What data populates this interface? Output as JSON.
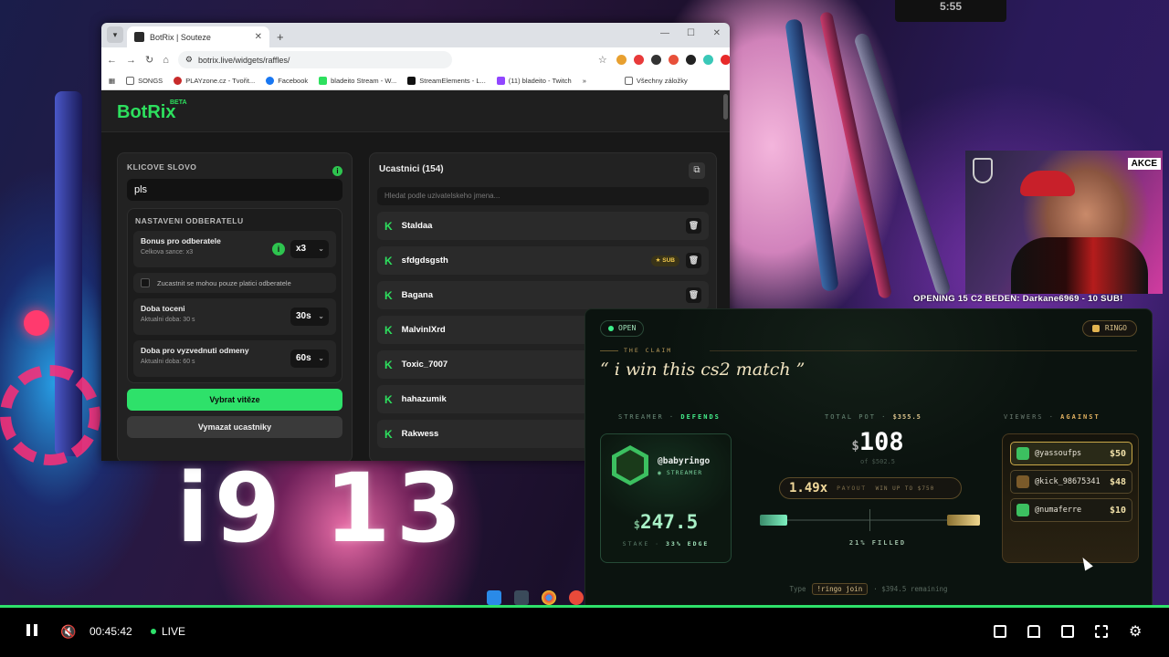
{
  "stream": {
    "top_marker": "5:55",
    "overlay_big_text": "i9 13",
    "ticker": "OPENING 15 C2 BEDEN: Darkane6969 - 10 SUB!",
    "cam_badge": "AKCE"
  },
  "browser": {
    "tab_title": "BotRix | Souteze",
    "url": "botrix.live/widgets/raffles/",
    "bookmarks": [
      "SONGS",
      "PLAYzone.cz - Tvořit...",
      "Facebook",
      "bladeito Stream - W...",
      "StreamElements - L...",
      "(11) bladeito - Twitch"
    ],
    "bookmarks_all": "Všechny záložky"
  },
  "botrix": {
    "brand": "BotRix",
    "beta": "BETA",
    "keyword_label": "KLICOVE SLOVO",
    "keyword_value": "pls",
    "sub_settings_label": "NASTAVENI ODBERATELU",
    "bonus": {
      "title": "Bonus pro odberatele",
      "subtitle": "Celkova sance: x3",
      "value": "x3"
    },
    "only_subs": "Zucastnit se mohou pouze platici odberatele",
    "spin": {
      "title": "Doba toceni",
      "subtitle": "Aktualni doba: 30 s",
      "value": "30s"
    },
    "claim": {
      "title": "Doba pro vyzvednuti odmeny",
      "subtitle": "Aktualni doba: 60 s",
      "value": "60s"
    },
    "pick_winner": "Vybrat vitěze",
    "clear_participants": "Vymazat ucastniky",
    "participants_title": "Ucastnici (154)",
    "search_placeholder": "Hledat podle uzivatelskeho jmena...",
    "participants": [
      {
        "name": "Staldaa",
        "badge": ""
      },
      {
        "name": "sfdgdsgsth",
        "badge": "SUB"
      },
      {
        "name": "Bagana",
        "badge": ""
      },
      {
        "name": "MalvinlXrd",
        "badge": ""
      },
      {
        "name": "Toxic_7007",
        "badge": ""
      },
      {
        "name": "hahazumik",
        "badge": ""
      },
      {
        "name": "Rakwess",
        "badge": ""
      }
    ]
  },
  "ringo": {
    "status": "OPEN",
    "brand": "RINGO",
    "claim_label": "THE CLAIM",
    "claim": "“ i win this cs2 match ”",
    "streamer_label": "STREAMER",
    "streamer_side": "DEFENDS",
    "streamer_handle": "@babyringo",
    "streamer_role": "STREAMER",
    "stake_amount": "247.5",
    "stake_label": "STAKE",
    "stake_edge": "33% EDGE",
    "pot_label": "TOTAL POT",
    "pot_total": "$355.5",
    "pot_amount": "108",
    "pot_of": "of $502.5",
    "multiplier": "1.49x",
    "payout_label": "PAYOUT",
    "win_up_to": "WIN UP TO $750",
    "filled_pct": 21,
    "filled_label": "21% FILLED",
    "viewers_label": "VIEWERS",
    "viewers_side": "AGAINST",
    "viewers": [
      {
        "name": "@yassoufps",
        "amount": "$50"
      },
      {
        "name": "@kick_98675341",
        "amount": "$48"
      },
      {
        "name": "@numaferre",
        "amount": "$10"
      }
    ],
    "footer_type": "Type",
    "footer_cmd": "!ringo join",
    "footer_remaining": "$394.5 remaining"
  },
  "player": {
    "time": "00:45:42",
    "live": "LIVE"
  },
  "colors": {
    "accent": "#2ee16a",
    "gold": "#d8c08a",
    "bg": "#0b120e"
  }
}
